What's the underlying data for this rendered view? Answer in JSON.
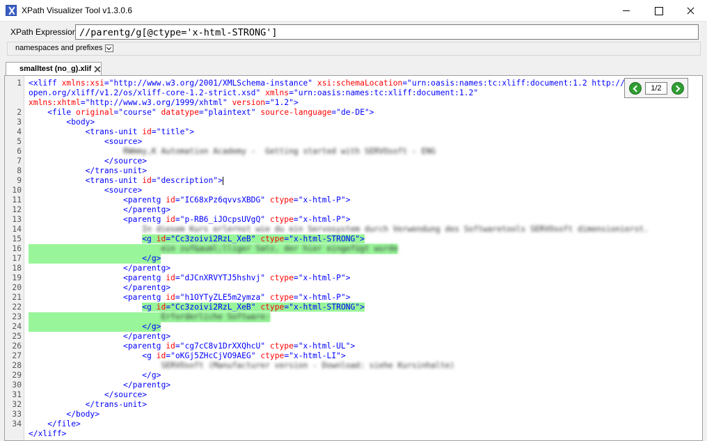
{
  "window": {
    "title": "XPath Visualizer Tool v1.3.0.6"
  },
  "xpath": {
    "label": "XPath Expression",
    "value": "//parentg/g[@ctype='x-html-STRONG']"
  },
  "namespaces": {
    "label": "namespaces and prefixes"
  },
  "tab": {
    "label": "smalltest (no_g).xlif"
  },
  "navigator": {
    "count": "1/2"
  },
  "colors": {
    "highlight": "#99f59a",
    "tag": "#0000ff",
    "attribute": "#ff0000"
  },
  "editor": {
    "lines": [
      {
        "no": "1",
        "s": [
          [
            "<",
            "pn"
          ],
          [
            "xliff",
            "tg"
          ],
          [
            " xmlns:xsi",
            "at"
          ],
          [
            "=",
            "pn"
          ],
          [
            "\"http://www.w3.org/2001/XMLSchema-instance\"",
            "va"
          ],
          [
            " xsi:schemaLocation",
            "at"
          ],
          [
            "=",
            "pn"
          ],
          [
            "\"urn:oasis:names:tc:xliff:document:1.2 http://docs.oasis-",
            "va"
          ]
        ]
      },
      {
        "no": "",
        "s": [
          [
            "open.org/xliff/v1.2/os/xliff-core-1.2-strict.xsd\"",
            "va"
          ],
          [
            " xmlns",
            "at"
          ],
          [
            "=",
            "pn"
          ],
          [
            "\"urn:oasis:names:tc:xliff:document:1.2\"",
            "va"
          ]
        ]
      },
      {
        "no": "",
        "s": [
          [
            "xmlns:xhtml",
            "at"
          ],
          [
            "=",
            "pn"
          ],
          [
            "\"http://www.w3.org/1999/xhtml\"",
            "va"
          ],
          [
            " version",
            "at"
          ],
          [
            "=",
            "pn"
          ],
          [
            "\"1.2\"",
            "va"
          ],
          [
            ">",
            "pn"
          ]
        ]
      },
      {
        "no": "2",
        "s": [
          [
            "    <",
            "pn"
          ],
          [
            "file",
            "tg"
          ],
          [
            " original",
            "at"
          ],
          [
            "=",
            "pn"
          ],
          [
            "\"course\"",
            "va"
          ],
          [
            " datatype",
            "at"
          ],
          [
            "=",
            "pn"
          ],
          [
            "\"plaintext\"",
            "va"
          ],
          [
            " source-language",
            "at"
          ],
          [
            "=",
            "pn"
          ],
          [
            "\"de-DE\"",
            "va"
          ],
          [
            ">",
            "pn"
          ]
        ]
      },
      {
        "no": "3",
        "s": [
          [
            "        <",
            "pn"
          ],
          [
            "body",
            "tg"
          ],
          [
            ">",
            "pn"
          ]
        ]
      },
      {
        "no": "4",
        "s": [
          [
            "            <",
            "pn"
          ],
          [
            "trans-unit",
            "tg"
          ],
          [
            " id",
            "at"
          ],
          [
            "=",
            "pn"
          ],
          [
            "\"title\"",
            "va"
          ],
          [
            ">",
            "pn"
          ]
        ]
      },
      {
        "no": "5",
        "s": [
          [
            "                <",
            "pn"
          ],
          [
            "source",
            "tg"
          ],
          [
            ">",
            "pn"
          ]
        ]
      },
      {
        "no": "6",
        "s": [
          [
            "                    ",
            "pn"
          ],
          [
            "RWmmy,K Automation Academy -  Getting started with SERVOsoft - ENG",
            "tx"
          ]
        ]
      },
      {
        "no": "7",
        "s": [
          [
            "                </",
            "pn"
          ],
          [
            "source",
            "tg"
          ],
          [
            ">",
            "pn"
          ]
        ]
      },
      {
        "no": "8",
        "s": [
          [
            "            </",
            "pn"
          ],
          [
            "trans-unit",
            "tg"
          ],
          [
            ">",
            "pn"
          ]
        ]
      },
      {
        "no": "9",
        "caret": true,
        "s": [
          [
            "            <",
            "pn"
          ],
          [
            "trans-unit",
            "tg"
          ],
          [
            " id",
            "at"
          ],
          [
            "=",
            "pn"
          ],
          [
            "\"description\"",
            "va"
          ],
          [
            ">",
            "pn"
          ]
        ]
      },
      {
        "no": "10",
        "s": [
          [
            "                <",
            "pn"
          ],
          [
            "source",
            "tg"
          ],
          [
            ">",
            "pn"
          ]
        ]
      },
      {
        "no": "11",
        "s": [
          [
            "                    <",
            "pn"
          ],
          [
            "parentg",
            "tg"
          ],
          [
            " id",
            "at"
          ],
          [
            "=",
            "pn"
          ],
          [
            "\"IC68xPz6qvvsXBDG\"",
            "va"
          ],
          [
            " ctype",
            "at"
          ],
          [
            "=",
            "pn"
          ],
          [
            "\"x-html-P\"",
            "va"
          ],
          [
            ">",
            "pn"
          ]
        ]
      },
      {
        "no": "12",
        "s": [
          [
            "                    </",
            "pn"
          ],
          [
            "parentg",
            "tg"
          ],
          [
            ">",
            "pn"
          ]
        ]
      },
      {
        "no": "13",
        "s": [
          [
            "                    <",
            "pn"
          ],
          [
            "parentg",
            "tg"
          ],
          [
            " id",
            "at"
          ],
          [
            "=",
            "pn"
          ],
          [
            "\"p-RB6_iJOcpsUVgQ\"",
            "va"
          ],
          [
            " ctype",
            "at"
          ],
          [
            "=",
            "pn"
          ],
          [
            "\"x-html-P\"",
            "va"
          ],
          [
            ">",
            "pn"
          ]
        ]
      },
      {
        "no": "14",
        "s": [
          [
            "                        ",
            "pn"
          ],
          [
            "In diesem Kurs erlernst wie du ein Servosystem durch Verwendung des Softwaretools SERVOsoft dimensionierst.",
            "tx"
          ]
        ]
      },
      {
        "no": "15",
        "hl": "1",
        "s": [
          [
            "                        ",
            "pn"
          ],
          [
            "<",
            "pnh"
          ],
          [
            "g",
            "tgh"
          ],
          [
            " id",
            "ath"
          ],
          [
            "=",
            "pnh"
          ],
          [
            "\"Cc3zoivi2RzL_XeB\"",
            "vah"
          ],
          [
            " ctype",
            "ath"
          ],
          [
            "=",
            "pnh"
          ],
          [
            "\"x-html-STRONG\"",
            "vah"
          ],
          [
            ">",
            "pnh"
          ]
        ]
      },
      {
        "no": "16",
        "hl": "2",
        "s": [
          [
            "                            ",
            "pn"
          ],
          [
            "ein zuf&auml;lliger Satz, der hier eingefügt wurde",
            "txh"
          ]
        ]
      },
      {
        "no": "17",
        "hl": "3",
        "s": [
          [
            "                        ",
            "pn"
          ],
          [
            "</",
            "pnh"
          ],
          [
            "g",
            "tgh"
          ],
          [
            ">",
            "pnh"
          ]
        ]
      },
      {
        "no": "18",
        "s": [
          [
            "                    </",
            "pn"
          ],
          [
            "parentg",
            "tg"
          ],
          [
            ">",
            "pn"
          ]
        ]
      },
      {
        "no": "19",
        "s": [
          [
            "                    <",
            "pn"
          ],
          [
            "parentg",
            "tg"
          ],
          [
            " id",
            "at"
          ],
          [
            "=",
            "pn"
          ],
          [
            "\"dJCnXRVYTJ5hshvj\"",
            "va"
          ],
          [
            " ctype",
            "at"
          ],
          [
            "=",
            "pn"
          ],
          [
            "\"x-html-P\"",
            "va"
          ],
          [
            ">",
            "pn"
          ]
        ]
      },
      {
        "no": "20",
        "s": [
          [
            "                    </",
            "pn"
          ],
          [
            "parentg",
            "tg"
          ],
          [
            ">",
            "pn"
          ]
        ]
      },
      {
        "no": "21",
        "s": [
          [
            "                    <",
            "pn"
          ],
          [
            "parentg",
            "tg"
          ],
          [
            " id",
            "at"
          ],
          [
            "=",
            "pn"
          ],
          [
            "\"h1OYTyZLE5m2ymza\"",
            "va"
          ],
          [
            " ctype",
            "at"
          ],
          [
            "=",
            "pn"
          ],
          [
            "\"x-html-P\"",
            "va"
          ],
          [
            ">",
            "pn"
          ]
        ]
      },
      {
        "no": "22",
        "hl": "1",
        "s": [
          [
            "                        ",
            "pn"
          ],
          [
            "<",
            "pnh"
          ],
          [
            "g",
            "tgh"
          ],
          [
            " id",
            "ath"
          ],
          [
            "=",
            "pnh"
          ],
          [
            "\"Cc3zoivi2RzL_XeB\"",
            "vah"
          ],
          [
            " ctype",
            "ath"
          ],
          [
            "=",
            "pnh"
          ],
          [
            "\"x-html-STRONG\"",
            "vah"
          ],
          [
            ">",
            "pnh"
          ]
        ]
      },
      {
        "no": "23",
        "hl": "2",
        "s": [
          [
            "                            ",
            "pn"
          ],
          [
            "Erforderliche Software:",
            "txh"
          ]
        ]
      },
      {
        "no": "24",
        "hl": "3",
        "s": [
          [
            "                        ",
            "pn"
          ],
          [
            "</",
            "pnh"
          ],
          [
            "g",
            "tgh"
          ],
          [
            ">",
            "pnh"
          ]
        ]
      },
      {
        "no": "25",
        "s": [
          [
            "                    </",
            "pn"
          ],
          [
            "parentg",
            "tg"
          ],
          [
            ">",
            "pn"
          ]
        ]
      },
      {
        "no": "26",
        "s": [
          [
            "                    <",
            "pn"
          ],
          [
            "parentg",
            "tg"
          ],
          [
            " id",
            "at"
          ],
          [
            "=",
            "pn"
          ],
          [
            "\"cg7cC8v1DrXXQhcU\"",
            "va"
          ],
          [
            " ctype",
            "at"
          ],
          [
            "=",
            "pn"
          ],
          [
            "\"x-html-UL\"",
            "va"
          ],
          [
            ">",
            "pn"
          ]
        ]
      },
      {
        "no": "27",
        "s": [
          [
            "                        <",
            "pn"
          ],
          [
            "g",
            "tg"
          ],
          [
            " id",
            "at"
          ],
          [
            "=",
            "pn"
          ],
          [
            "\"oKGj5ZHcCjVO9AEG\"",
            "va"
          ],
          [
            " ctype",
            "at"
          ],
          [
            "=",
            "pn"
          ],
          [
            "\"x-html-LI\"",
            "va"
          ],
          [
            ">",
            "pn"
          ]
        ]
      },
      {
        "no": "28",
        "s": [
          [
            "                            ",
            "pn"
          ],
          [
            "SERVOsoft (Manufacturer version - Download: siehe Kursinhalte)",
            "tx"
          ]
        ]
      },
      {
        "no": "29",
        "s": [
          [
            "                        </",
            "pn"
          ],
          [
            "g",
            "tg"
          ],
          [
            ">",
            "pn"
          ]
        ]
      },
      {
        "no": "30",
        "s": [
          [
            "                    </",
            "pn"
          ],
          [
            "parentg",
            "tg"
          ],
          [
            ">",
            "pn"
          ]
        ]
      },
      {
        "no": "31",
        "s": [
          [
            "                </",
            "pn"
          ],
          [
            "source",
            "tg"
          ],
          [
            ">",
            "pn"
          ]
        ]
      },
      {
        "no": "32",
        "s": [
          [
            "            </",
            "pn"
          ],
          [
            "trans-unit",
            "tg"
          ],
          [
            ">",
            "pn"
          ]
        ]
      },
      {
        "no": "33",
        "s": [
          [
            "        </",
            "pn"
          ],
          [
            "body",
            "tg"
          ],
          [
            ">",
            "pn"
          ]
        ]
      },
      {
        "no": "34",
        "s": [
          [
            "    </",
            "pn"
          ],
          [
            "file",
            "tg"
          ],
          [
            ">",
            "pn"
          ]
        ]
      },
      {
        "no": "",
        "s": [
          [
            "</",
            "pn"
          ],
          [
            "xliff",
            "tg"
          ],
          [
            ">",
            "pn"
          ]
        ]
      }
    ]
  }
}
